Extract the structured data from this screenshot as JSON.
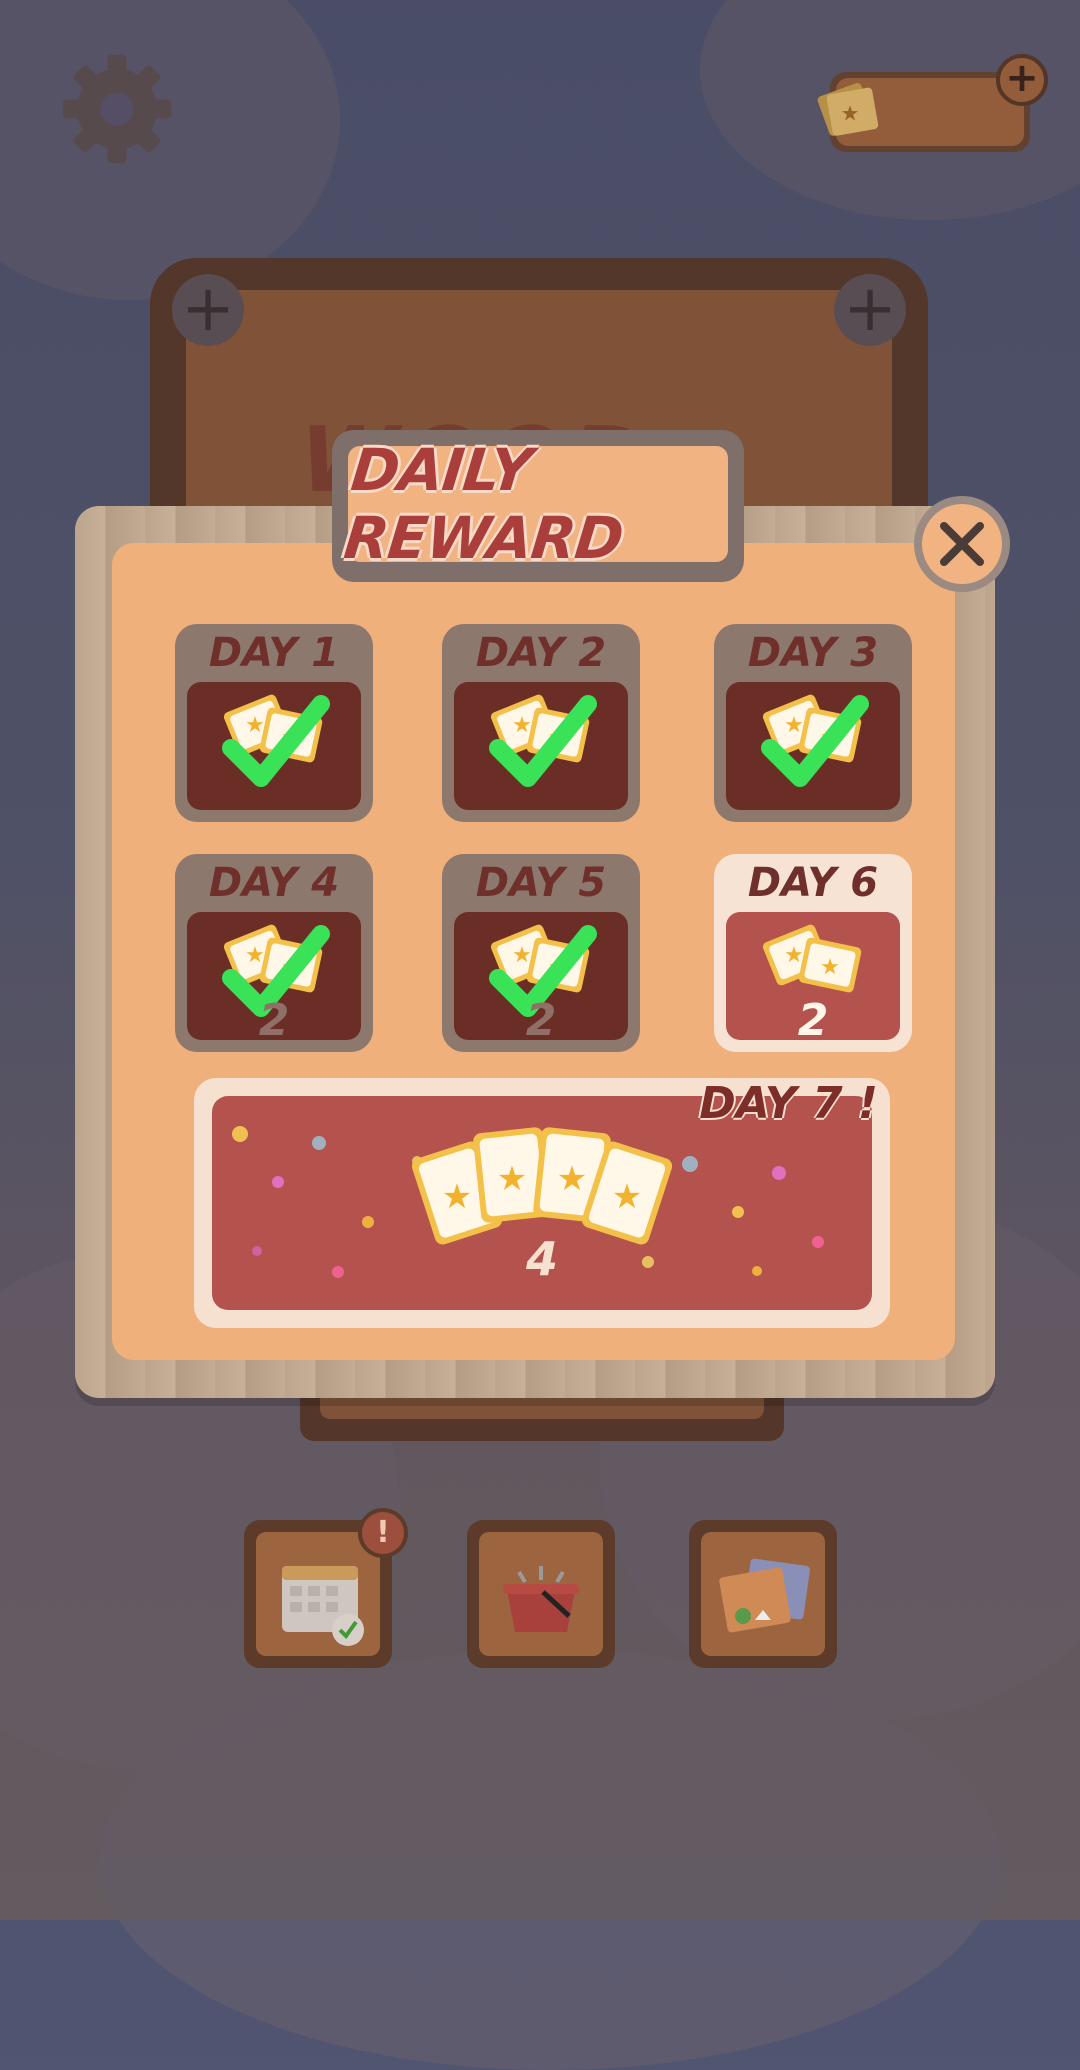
{
  "top_bar": {
    "settings_icon": "gear-icon",
    "ticket_count": "",
    "add_symbol": "+"
  },
  "board": {
    "title": "WOOD NUTS",
    "add_left": "+",
    "add_right": "+"
  },
  "modal": {
    "title": "DAILY REWARD",
    "close_icon": "close-icon",
    "days": [
      {
        "label": "DAY 1",
        "amount": "",
        "claimed": true
      },
      {
        "label": "DAY 2",
        "amount": "",
        "claimed": true
      },
      {
        "label": "DAY 3",
        "amount": "",
        "claimed": true
      },
      {
        "label": "DAY 4",
        "amount": "2",
        "claimed": true
      },
      {
        "label": "DAY 5",
        "amount": "2",
        "claimed": true
      },
      {
        "label": "DAY 6",
        "amount": "2",
        "claimed": false
      }
    ],
    "day7": {
      "label": "DAY 7 !",
      "amount": "4"
    }
  },
  "bottom_nav": {
    "items": [
      "calendar-icon",
      "basket-icon",
      "gallery-icon"
    ],
    "alert_badge": "!"
  },
  "colors": {
    "panel": "#f0b07c",
    "accent_red": "#a93e3b",
    "check_green": "#3ee85a"
  }
}
